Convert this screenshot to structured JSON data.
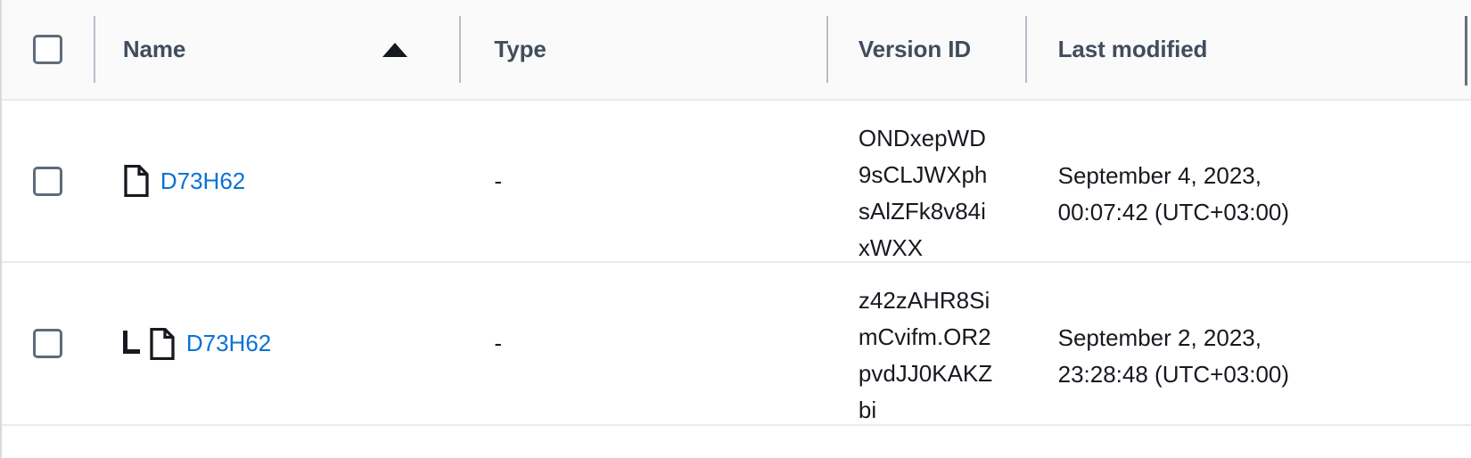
{
  "table": {
    "columns": [
      {
        "id": "select",
        "label": "",
        "icon": "checkbox-icon"
      },
      {
        "id": "name",
        "label": "Name",
        "sort": "ascending",
        "sort_icon": "sort-ascending-arrow-icon"
      },
      {
        "id": "type",
        "label": "Type"
      },
      {
        "id": "version_id",
        "label": "Version ID"
      },
      {
        "id": "last_modified",
        "label": "Last modified"
      }
    ],
    "select_all_checkbox": {
      "checked": false
    },
    "rows": [
      {
        "selected": false,
        "nested": false,
        "icon": "file-icon",
        "name": "D73H62",
        "type": "-",
        "version_id": "ONDxepWD9sCLJWXphsAlZFk8v84ixWXX",
        "last_modified": "September 4, 2023, 00:07:42 (UTC+03:00)"
      },
      {
        "selected": false,
        "nested": true,
        "icon": "file-icon",
        "tree_icon": "tree-elbow-icon",
        "name": "D73H62",
        "type": "-",
        "version_id": "z42zAHR8SimCvifm.OR2pvdJJ0KAKZbi",
        "last_modified": "September 2, 2023, 23:28:48 (UTC+03:00)"
      }
    ]
  },
  "colors": {
    "link": "#0972d3",
    "header_bg": "#fafafa",
    "header_text": "#414d5c",
    "body_text": "#16191f",
    "border": "#e9ebed",
    "divider": "#b6bec9",
    "checkbox_border": "#5f6b7a"
  }
}
